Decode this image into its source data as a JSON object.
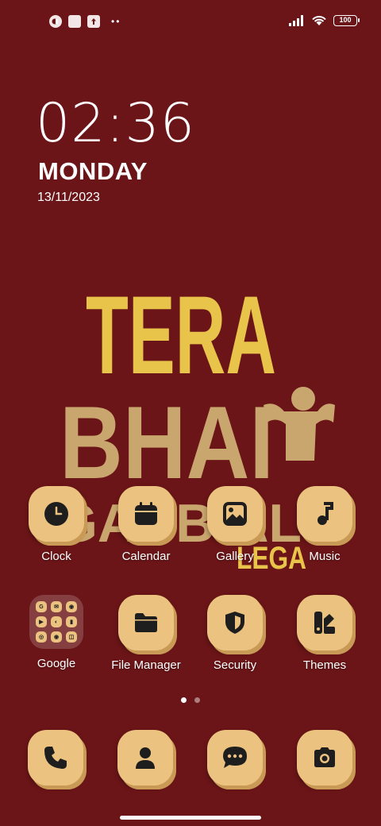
{
  "status_bar": {
    "battery": "100",
    "left_icons": [
      "notification-icon",
      "square-icon",
      "upload-icon"
    ],
    "right_icons": [
      "signal-icon",
      "wifi-icon",
      "battery-icon"
    ]
  },
  "lock_widget": {
    "time": "02:36",
    "day": "MONDAY",
    "date": "13/11/2023"
  },
  "wallpaper": {
    "line1": "TERA",
    "line2": "BHAI",
    "line3": "GABBIAL",
    "line4": "LEGA"
  },
  "apps_row1": [
    {
      "label": "Clock",
      "icon": "clock-icon"
    },
    {
      "label": "Calendar",
      "icon": "calendar-icon"
    },
    {
      "label": "Gallery",
      "icon": "image-icon"
    },
    {
      "label": "Music",
      "icon": "music-note-icon"
    }
  ],
  "apps_row2": [
    {
      "label": "Google",
      "icon": "folder-icon"
    },
    {
      "label": "File Manager",
      "icon": "folder-icon"
    },
    {
      "label": "Security",
      "icon": "shield-icon"
    },
    {
      "label": "Themes",
      "icon": "palette-icon"
    }
  ],
  "google_folder_items": [
    "G",
    "✉",
    "◉",
    "▶",
    "◐",
    "▮",
    "◎",
    "◉",
    "◫"
  ],
  "dock": [
    {
      "icon": "phone-icon"
    },
    {
      "icon": "contacts-icon"
    },
    {
      "icon": "messages-icon"
    },
    {
      "icon": "camera-icon"
    }
  ],
  "page_indicator": {
    "current": 1,
    "total": 2
  },
  "colors": {
    "background": "#6b1518",
    "icon_bg": "#ebc27f",
    "icon_glyph": "#1e1e1e",
    "wall_yellow": "#e9c44a",
    "wall_tan": "#c9a66e"
  }
}
